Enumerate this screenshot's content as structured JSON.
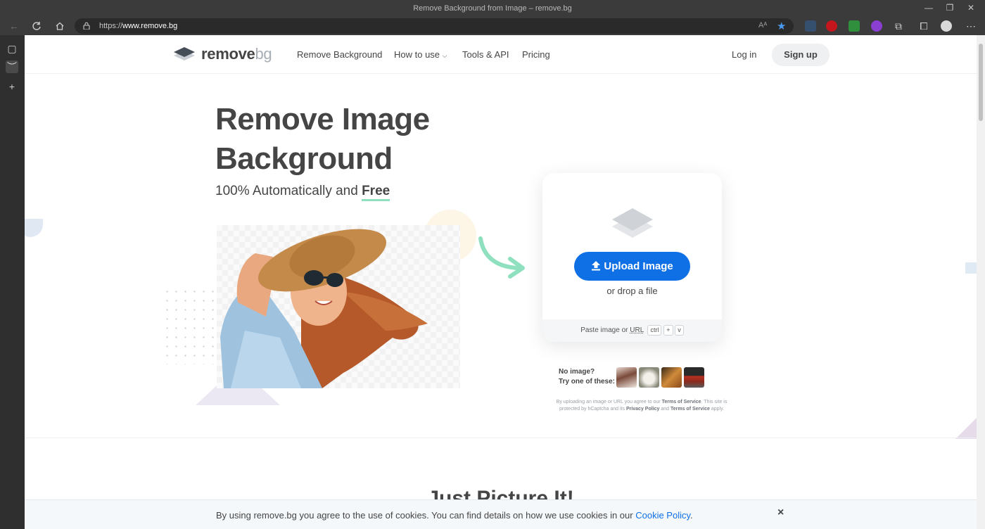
{
  "browser": {
    "window_title": "Remove Background from Image – remove.bg",
    "url_prefix": "https://",
    "url_domain": "www.remove.bg",
    "window_buttons": [
      "—",
      "❐",
      "✕"
    ]
  },
  "nav": {
    "logo_main": "remove",
    "logo_suffix": "bg",
    "links": [
      "Remove Background",
      "How to use",
      "Tools & API",
      "Pricing"
    ],
    "login": "Log in",
    "signup": "Sign up"
  },
  "hero": {
    "title_line1": "Remove Image",
    "title_line2": "Background",
    "subtitle_prefix": "100% Automatically and ",
    "subtitle_highlight": "Free"
  },
  "upload": {
    "button_label": "Upload Image",
    "drop_text": "or drop a file",
    "paste_text": "Paste image or ",
    "paste_url": "URL",
    "kbd_ctrl": "ctrl",
    "kbd_plus": "+",
    "kbd_v": "v"
  },
  "samples": {
    "line1": "No image?",
    "line2": "Try one of these:"
  },
  "terms": {
    "t1": "By uploading an image or URL you agree to our ",
    "tos1": "Terms of Service",
    "t2": ". This site is protected by hCaptcha and its ",
    "privacy": "Privacy Policy",
    "t3": " and ",
    "tos2": "Terms of Service",
    "t4": " apply."
  },
  "next_section": {
    "title": "Just Picture It!"
  },
  "cookie": {
    "text": "By using remove.bg you agree to the use of cookies. You can find details on how we use cookies in our ",
    "link": "Cookie Policy",
    "suffix": ".",
    "close": "×"
  },
  "colors": {
    "accent_blue": "#0f70e6",
    "text_dark": "#454545",
    "highlight_green": "#8fe0bf",
    "chrome_bg": "#3b3b3b"
  }
}
